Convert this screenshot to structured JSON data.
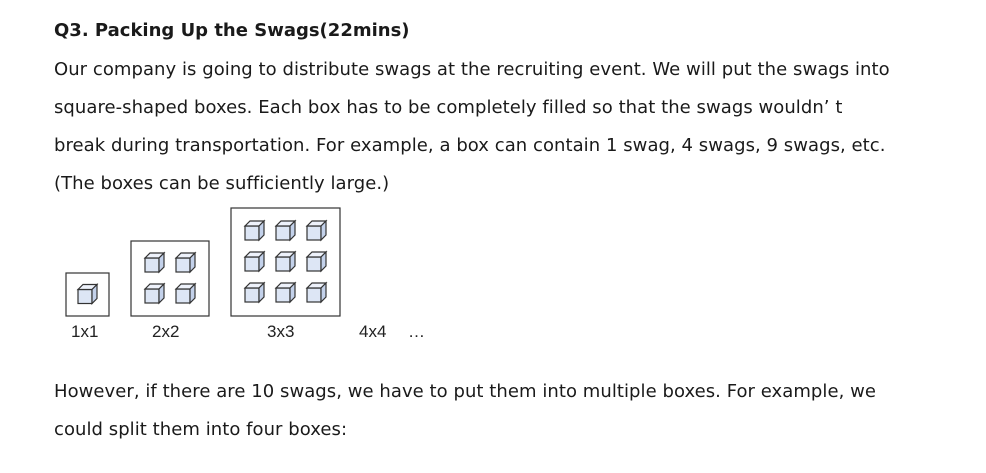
{
  "question": {
    "title": "Q3. Packing Up the Swags(22mins)",
    "lines": [
      "Our company is going to distribute swags at the recruiting event. We will put the swags into",
      "square-shaped boxes. Each box has to be completely filled so that the swags wouldn’ t",
      "break during transportation. For example, a box can contain 1 swag, 4 swags, 9 swags, etc.",
      "(The boxes can be sufficiently large.)"
    ],
    "after_lines": [
      "However, if there are 10 swags, we have to put them into multiple boxes. For example, we",
      "could split them into four boxes:"
    ]
  },
  "figure": {
    "boxes": [
      {
        "label": "1x1",
        "size": 1
      },
      {
        "label": "2x2",
        "size": 2
      },
      {
        "label": "3x3",
        "size": 3
      }
    ],
    "next_label": "4x4",
    "ellipsis": "…",
    "cube_icon": "cube-icon",
    "cube_fill": "#dde6f5",
    "cube_top": "#eef2fb",
    "cube_side": "#c3d1ea",
    "stroke": "#333333"
  }
}
